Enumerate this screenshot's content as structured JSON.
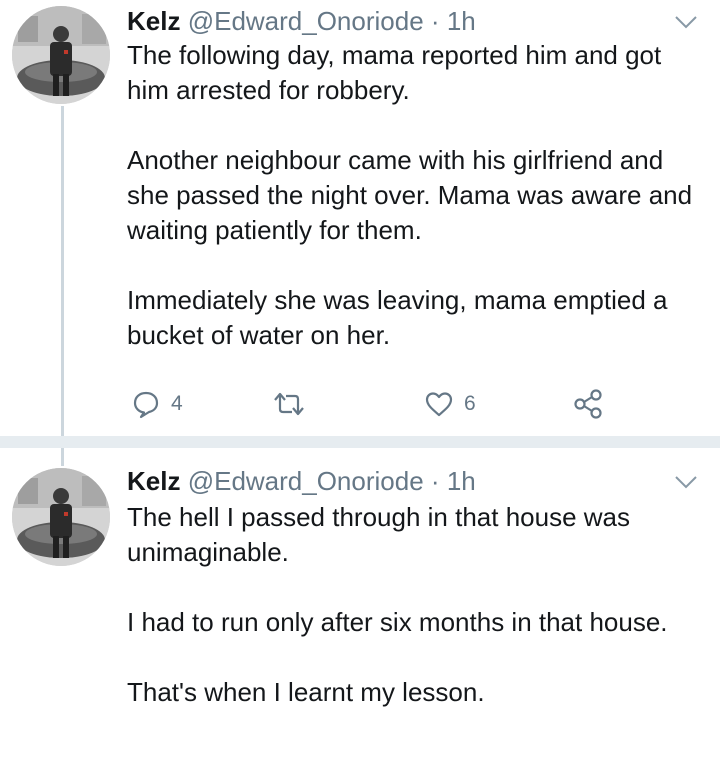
{
  "tweets": [
    {
      "author": {
        "name": "Kelz",
        "handle": "@Edward_Onoriode",
        "separator": "·",
        "time": "1h",
        "avatar": "avatar-photo"
      },
      "paragraphs": [
        "The following day, mama reported him and got him arrested for robbery.",
        "Another neighbour came with his girlfriend and she passed the night over. Mama was aware and waiting patiently for them.",
        "Immediately she was leaving, mama emptied a bucket of water on her."
      ],
      "actions": {
        "reply_count": "4",
        "retweet_count": "",
        "like_count": "6"
      }
    },
    {
      "author": {
        "name": "Kelz",
        "handle": "@Edward_Onoriode",
        "separator": "·",
        "time": "1h",
        "avatar": "avatar-photo"
      },
      "paragraphs": [
        "The hell I passed through in that house was unimaginable.",
        "I had to run only after six months in that house.",
        "That's when I learnt my lesson."
      ]
    }
  ],
  "icons": {
    "reply": "reply-icon",
    "retweet": "retweet-icon",
    "like": "heart-icon",
    "share": "share-icon",
    "menu": "chevron-down-icon"
  },
  "colors": {
    "text": "#14171a",
    "secondary": "#657786",
    "thread_line": "#ccd6dd",
    "separator": "#e6ecf0"
  }
}
